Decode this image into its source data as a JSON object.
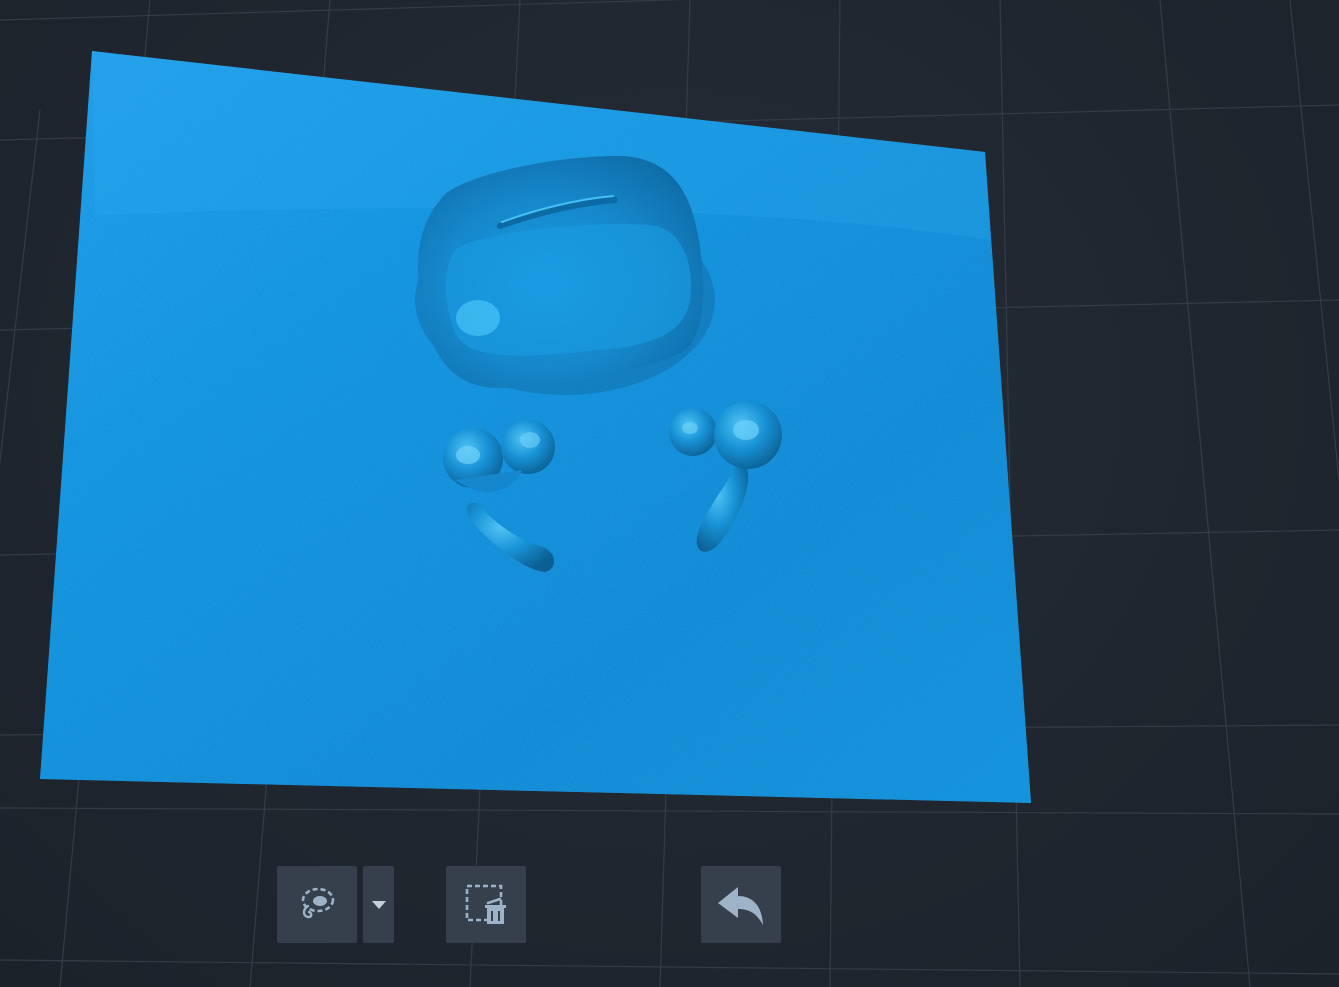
{
  "app": {
    "view": "3d-scan-viewport"
  },
  "colors": {
    "background": "#1f262f",
    "grid_line": "#323c48",
    "mesh": "#1596dc",
    "mesh_highlight": "#2fb3f2",
    "mesh_shadow": "#0b6fad",
    "toolbar_button": "#36404d",
    "icon": "#9fb3c8"
  },
  "scene": {
    "objects": [
      {
        "name": "scan-surface"
      },
      {
        "name": "earbuds-case"
      },
      {
        "name": "left-earbud"
      },
      {
        "name": "right-earbud"
      }
    ]
  },
  "toolbar": {
    "buttons": [
      {
        "name": "lasso-select-button",
        "icon": "lasso-icon"
      },
      {
        "name": "select-mode-dropdown-button",
        "icon": "caret-down-icon"
      },
      {
        "name": "delete-selection-button",
        "icon": "delete-selection-icon"
      },
      {
        "name": "undo-button",
        "icon": "undo-icon"
      }
    ]
  }
}
